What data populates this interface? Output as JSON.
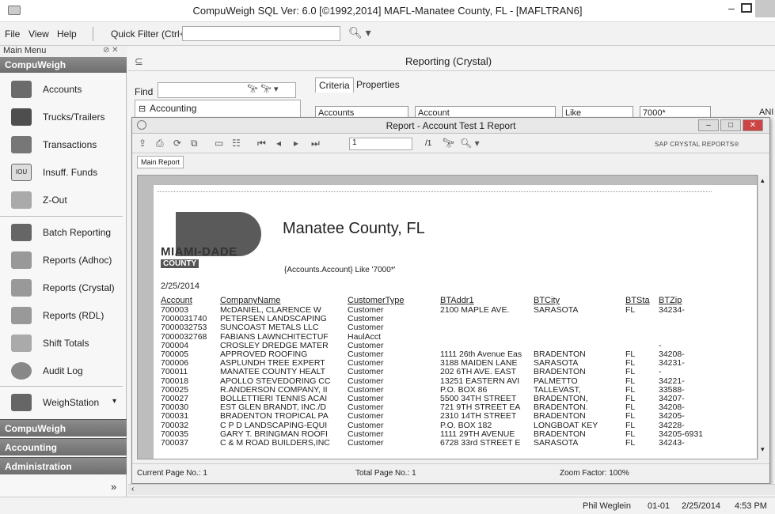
{
  "titlebar": {
    "title": "CompuWeigh  SQL Ver: 6.0 [©1992,2014]  MAFL-Manatee County, FL - [MAFLTRAN6]",
    "min": "–"
  },
  "menu": {
    "file": "File",
    "view": "View",
    "help": "Help",
    "quick_filter": "Quick Filter (Ctrl+Q)"
  },
  "sidebar": {
    "header": "Main Menu",
    "group_top": "CompuWeigh",
    "items": [
      {
        "label": "Accounts",
        "icon": "accounts-icon",
        "color": "#6b6b6b"
      },
      {
        "label": "Trucks/Trailers",
        "icon": "truck-icon",
        "color": "#4e4e4e"
      },
      {
        "label": "Transactions",
        "icon": "transactions-icon",
        "color": "#777777"
      },
      {
        "label": "Insuff. Funds",
        "icon": "iou-icon",
        "color": "#dddddd"
      },
      {
        "label": "Z-Out",
        "icon": "z-out-icon",
        "color": "#aaaaaa"
      },
      {
        "label": "Batch Reporting",
        "icon": "batch-reporting-icon",
        "color": "#666666"
      },
      {
        "label": "Reports (Adhoc)",
        "icon": "reports-adhoc-icon",
        "color": "#999999"
      },
      {
        "label": "Reports (Crystal)",
        "icon": "reports-crystal-icon",
        "color": "#999999"
      },
      {
        "label": "Reports (RDL)",
        "icon": "reports-rdl-icon",
        "color": "#999999"
      },
      {
        "label": "Shift Totals",
        "icon": "shift-totals-icon",
        "color": "#aaaaaa"
      },
      {
        "label": "Audit Log",
        "icon": "audit-log-icon",
        "color": "#888888"
      },
      {
        "label": "WeighStation",
        "icon": "weighstation-icon",
        "color": "#666666"
      }
    ],
    "groups": [
      "CompuWeigh",
      "Accounting",
      "Administration"
    ]
  },
  "main": {
    "title": "Reporting (Crystal)",
    "find_label": "Find",
    "tree_root": "Accounting",
    "tabs": [
      "Criteria",
      "Properties"
    ],
    "criteria": {
      "field_table": "Accounts",
      "field_column": "Account",
      "operator": "Like",
      "value": "7000*",
      "conj": "ANI"
    }
  },
  "report_window": {
    "title": "Report - Account Test 1 Report",
    "page_input": "1",
    "page_total": "/1",
    "sap_label": "SAP CRYSTAL REPORTS®",
    "tab": "Main Report",
    "status": {
      "current_page": "Current Page No.: 1",
      "total_page": "Total Page No.: 1",
      "zoom": "Zoom Factor: 100%"
    }
  },
  "report": {
    "logo_line1": "MIAMI-DADE",
    "logo_line2": "COUNTY",
    "title": "Manatee County, FL",
    "filter": "{Accounts.Account} Like '7000*'",
    "date": "2/25/2014",
    "columns": [
      "Account",
      "CompanyName",
      "CustomerType",
      "BTAddr1",
      "BTCity",
      "BTSta",
      "BTZip"
    ],
    "rows": [
      [
        "700003",
        "McDANIEL, CLARENCE W",
        "Customer",
        "2100 MAPLE AVE.",
        "SARASOTA",
        "FL",
        "34234-"
      ],
      [
        "7000031740",
        "PETERSEN LANDSCAPING",
        "Customer",
        "",
        "",
        "",
        ""
      ],
      [
        "7000032753",
        "SUNCOAST METALS LLC",
        "Customer",
        "",
        "",
        "",
        ""
      ],
      [
        "7000032768",
        "FABIANS LAWNCHITECTUF",
        "HaulAcct",
        "",
        "",
        "",
        ""
      ],
      [
        "700004",
        "CROSLEY DREDGE MATER",
        "Customer",
        "",
        "",
        "",
        "-"
      ],
      [
        "700005",
        "APPROVED ROOFING",
        "Customer",
        "1111 26th Avenue Eas",
        "BRADENTON",
        "FL",
        "34208-"
      ],
      [
        "700006",
        "ASPLUNDH TREE EXPERT",
        "Customer",
        "3188 MAIDEN LANE",
        "SARASOTA",
        "FL",
        "34231-"
      ],
      [
        "700011",
        "MANATEE COUNTY HEALT",
        "Customer",
        "202 6TH AVE. EAST",
        "BRADENTON",
        "FL",
        "-"
      ],
      [
        "700018",
        "APOLLO STEVEDORING CC",
        "Customer",
        "13251 EASTERN AVI",
        "PALMETTO",
        "FL",
        "34221-"
      ],
      [
        "700025",
        "R.ANDERSON COMPANY, II",
        "Customer",
        "P.O. BOX 86",
        "TALLEVAST,",
        "FL",
        "33588-"
      ],
      [
        "700027",
        "BOLLETTIERI TENNIS ACAI",
        "Customer",
        "5500 34TH STREET",
        "BRADENTON,",
        "FL",
        "34207-"
      ],
      [
        "700030",
        "EST GLEN BRANDT, INC./D",
        "Customer",
        "721 9TH STREET EA",
        "BRADENTON.",
        "FL",
        "34208-"
      ],
      [
        "700031",
        "BRADENTON TROPICAL PA",
        "Customer",
        "2310 14TH STREET",
        "BRADENTON",
        "FL",
        "34205-"
      ],
      [
        "700032",
        "C P D LANDSCAPING-EQUI",
        "Customer",
        "P.O. BOX 182",
        "LONGBOAT KEY",
        "FL",
        "34228-"
      ],
      [
        "700035",
        "GARY T. BRINGMAN ROOFI",
        "Customer",
        "1111 29TH AVENUE",
        "BRADENTON",
        "FL",
        "34205-6931"
      ],
      [
        "700037",
        "C & M ROAD BUILDERS,INC",
        "Customer",
        "6728 33rd STREET E",
        "SARASOTA",
        "FL",
        "34243-"
      ]
    ]
  },
  "statusbar": {
    "user": "Phil Weglein",
    "code": "01-01",
    "date": "2/25/2014",
    "time": "4:53 PM"
  }
}
